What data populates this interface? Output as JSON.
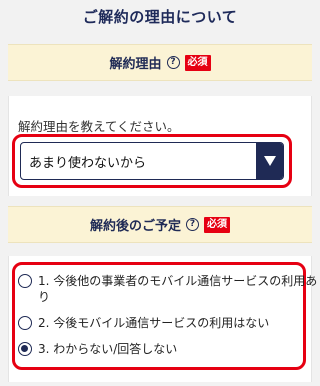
{
  "page": {
    "title": "ご解約の理由について"
  },
  "reason_section": {
    "label": "解約理由",
    "help": "?",
    "required": "必須",
    "prompt": "解約理由を教えてください。",
    "select": {
      "value": "あまり使わないから"
    }
  },
  "plan_section": {
    "label": "解約後のご予定",
    "help": "?",
    "required": "必須",
    "options": [
      {
        "label": "1. 今後他の事業者のモバイル通信サービスの利用あ",
        "label_cont": "り",
        "checked": false
      },
      {
        "label": "2. 今後モバイル通信サービスの利用はない",
        "checked": false
      },
      {
        "label": "3. わからない/回答しない",
        "checked": true
      }
    ]
  },
  "colors": {
    "accent": "#1f2a55",
    "required": "#e60012",
    "header_bg": "#fbf3d5",
    "highlight": "#e60012"
  },
  "icons": {
    "help": "help-circle-icon",
    "select_arrow": "triangle-down-icon",
    "radio": "radio-icon"
  }
}
